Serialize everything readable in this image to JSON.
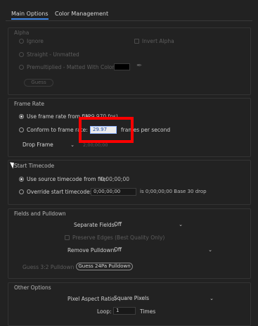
{
  "tabs": {
    "main": "Main Options",
    "color": "Color Management"
  },
  "alpha": {
    "heading": "Alpha",
    "ignore": "Ignore",
    "invert": "Invert Alpha",
    "straight": "Straight - Unmatted",
    "premult": "Premultiplied - Matted With Color:",
    "guess": "Guess",
    "matte_color": "#000000"
  },
  "frame_rate": {
    "heading": "Frame Rate",
    "use_file_label": "Use frame rate from file:",
    "use_file_value": "(29.970 fps)",
    "conform_label": "Conform to frame rate:",
    "conform_value": "29.97",
    "fps_suffix": "frames per second",
    "drop_frame": "Drop Frame",
    "partial": "2;00;00;00"
  },
  "timecode": {
    "heading": "Start Timecode",
    "use_source_label": "Use source timecode from file:",
    "use_source_value": "0;00;00;00",
    "override_label": "Override start timecode:",
    "override_value": "0;00;00;00",
    "is_text": "is 0;00;00;00  Base 30  drop"
  },
  "fields": {
    "heading": "Fields and Pulldown",
    "separate_label": "Separate Fields:",
    "separate_value": "Off",
    "preserve": "Preserve Edges (Best Quality Only)",
    "remove_label": "Remove Pulldown:",
    "remove_value": "Off",
    "guess32": "Guess 3:2 Pulldown",
    "guess24": "Guess 24Pa Pulldown"
  },
  "other": {
    "heading": "Other Options",
    "par_label": "Pixel Aspect Ratio:",
    "par_value": "Square Pixels",
    "loop_label": "Loop:",
    "loop_value": "1",
    "times": "Times"
  },
  "colors": {
    "accent": "#3e86e6",
    "annotation": "#ff0000"
  }
}
